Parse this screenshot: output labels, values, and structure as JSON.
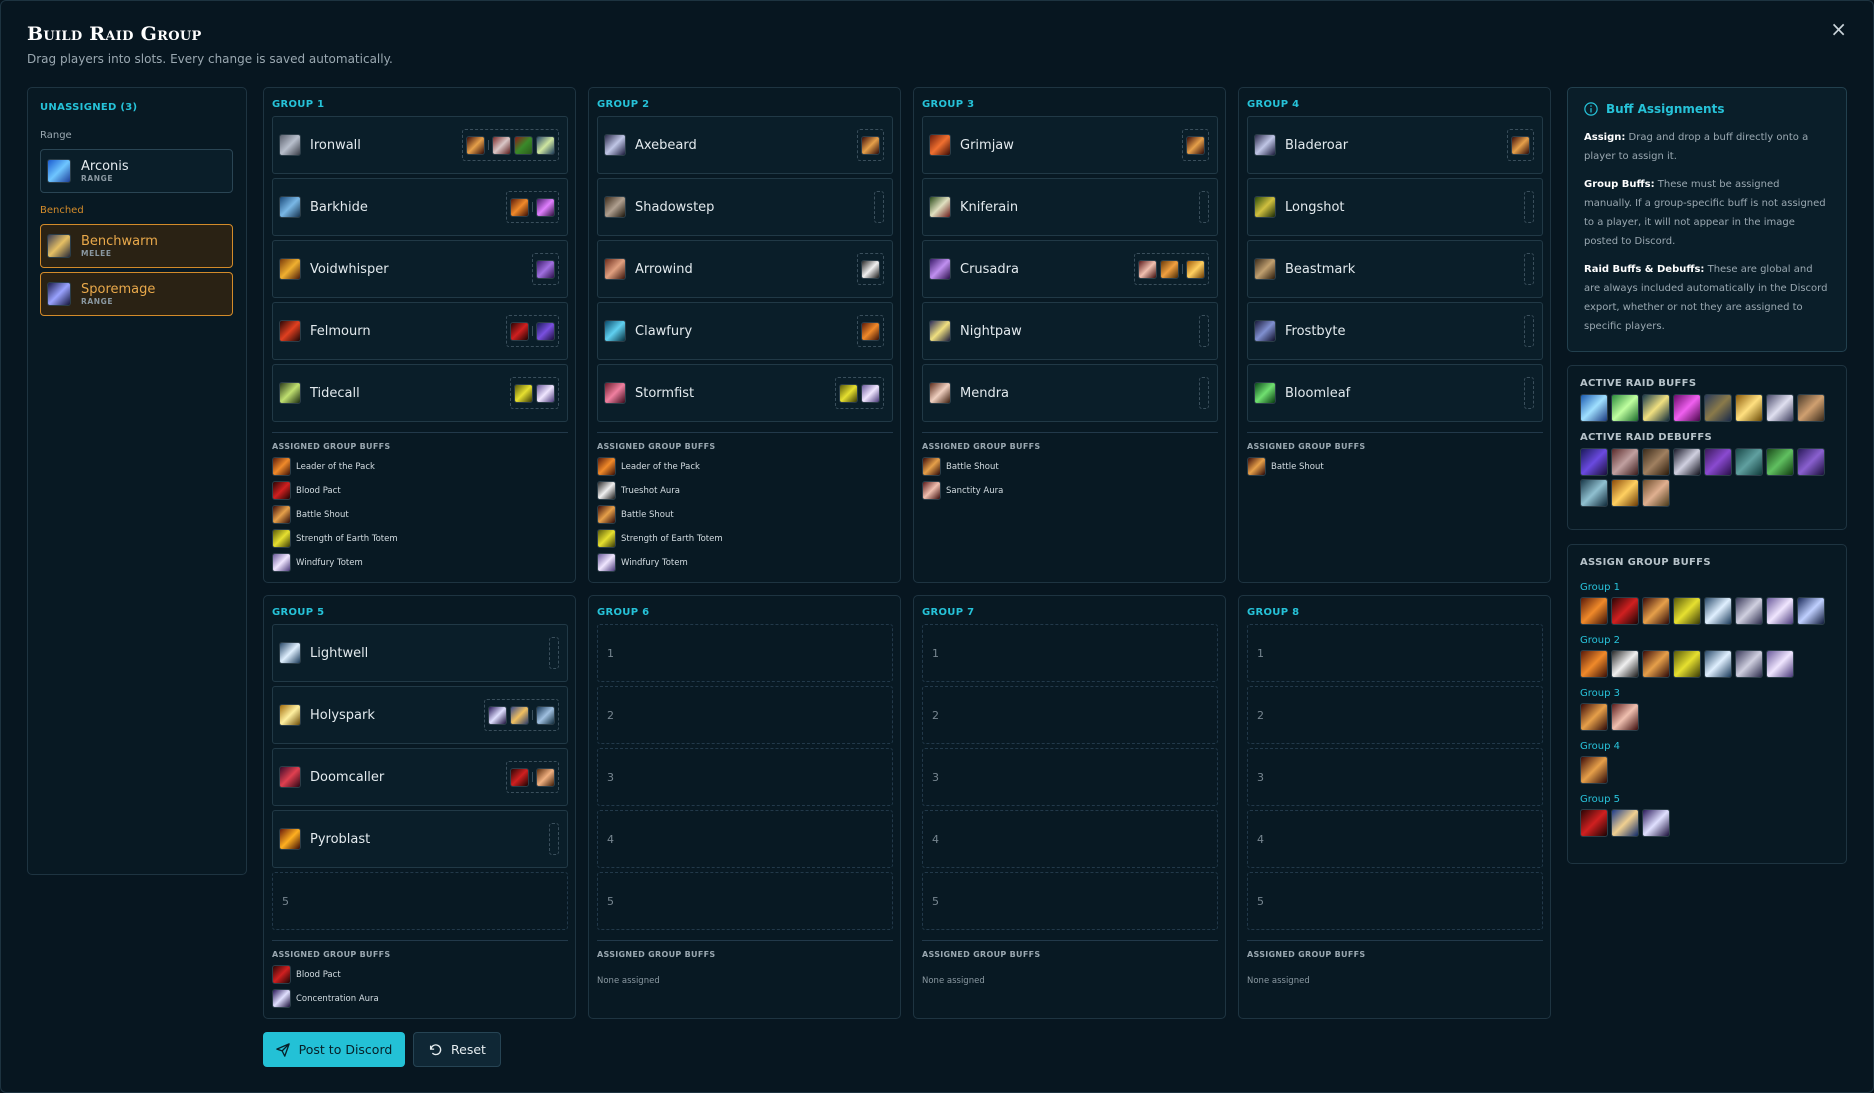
{
  "header": {
    "title": "Build Raid Group",
    "subtitle": "Drag players into slots. Every change is saved automatically.",
    "close": "×"
  },
  "unassigned": {
    "title": "UNASSIGNED (3)",
    "range_label": "Range",
    "benched_label": "Benched",
    "range_players": [
      {
        "name": "Arconis",
        "role": "RANGE",
        "icon": "frost-mage-icon"
      }
    ],
    "benched_players": [
      {
        "name": "Benchwarm",
        "role": "MELEE",
        "icon": "warrior-icon"
      },
      {
        "name": "Sporemage",
        "role": "RANGE",
        "icon": "shadow-priest-icon"
      }
    ]
  },
  "labels": {
    "assigned_group_buffs": "ASSIGNED GROUP BUFFS",
    "none_assigned": "None assigned"
  },
  "groups": [
    {
      "title": "GROUP 1",
      "players": [
        "Ironwall",
        "Barkhide",
        "Voidwhisper",
        "Felmourn",
        "Tidecall"
      ],
      "buffs": [
        "Leader of the Pack",
        "Blood Pact",
        "Battle Shout",
        "Strength of Earth Totem",
        "Windfury Totem"
      ]
    },
    {
      "title": "GROUP 2",
      "players": [
        "Axebeard",
        "Shadowstep",
        "Arrowind",
        "Clawfury",
        "Stormfist"
      ],
      "buffs": [
        "Leader of the Pack",
        "Trueshot Aura",
        "Battle Shout",
        "Strength of Earth Totem",
        "Windfury Totem"
      ]
    },
    {
      "title": "GROUP 3",
      "players": [
        "Grimjaw",
        "Kniferain",
        "Crusadra",
        "Nightpaw",
        "Mendra"
      ],
      "buffs": [
        "Battle Shout",
        "Sanctity Aura"
      ]
    },
    {
      "title": "GROUP 4",
      "players": [
        "Bladeroar",
        "Longshot",
        "Beastmark",
        "Frostbyte",
        "Bloomleaf"
      ],
      "buffs": [
        "Battle Shout"
      ]
    },
    {
      "title": "GROUP 5",
      "players": [
        "Lightwell",
        "Holyspark",
        "Doomcaller",
        "Pyroblast"
      ],
      "empty": [
        "5"
      ],
      "buffs": [
        "Blood Pact",
        "Concentration Aura"
      ]
    },
    {
      "title": "GROUP 6",
      "empty": [
        "1",
        "2",
        "3",
        "4",
        "5"
      ]
    },
    {
      "title": "GROUP 7",
      "empty": [
        "1",
        "2",
        "3",
        "4",
        "5"
      ]
    },
    {
      "title": "GROUP 8",
      "empty": [
        "1",
        "2",
        "3",
        "4",
        "5"
      ]
    }
  ],
  "buttons": {
    "post": "Post to Discord",
    "reset": "Reset"
  },
  "info": {
    "title": "Buff Assignments",
    "assign_label": "Assign:",
    "assign_text": " Drag and drop a buff directly onto a player to assign it.",
    "group_label": "Group Buffs:",
    "group_text": " These must be assigned manually. If a group-specific buff is not assigned to a player, it will not appear in the image posted to Discord.",
    "raid_label": "Raid Buffs & Debuffs:",
    "raid_text": " These are global and are always included automatically in the Discord export, whether or not they are assigned to specific players."
  },
  "active": {
    "buffs_title": "ACTIVE RAID BUFFS",
    "debuffs_title": "ACTIVE RAID DEBUFFS"
  },
  "assign_group": {
    "title": "ASSIGN GROUP BUFFS",
    "groups": [
      "Group 1",
      "Group 2",
      "Group 3",
      "Group 4",
      "Group 5"
    ]
  },
  "colors": {
    "accent": "#23c1d6",
    "benched": "#d38b2a"
  }
}
